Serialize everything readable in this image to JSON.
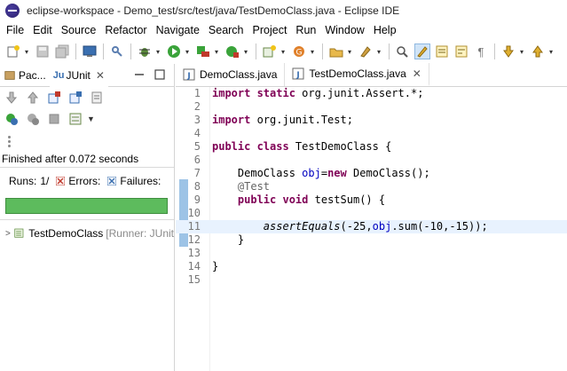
{
  "window": {
    "title": "eclipse-workspace - Demo_test/src/test/java/TestDemoClass.java - Eclipse IDE"
  },
  "menu": [
    "File",
    "Edit",
    "Source",
    "Refactor",
    "Navigate",
    "Search",
    "Project",
    "Run",
    "Window",
    "Help"
  ],
  "toolbar": {
    "icons": [
      "new-icon",
      "save-icon",
      "save-all-icon",
      "terminal-icon",
      "link-icon",
      "debug-icon",
      "run-icon",
      "coverage-icon",
      "external-tools-icon",
      "new-class-icon",
      "open-task-icon",
      "toggle-breadcrumb-icon",
      "mark-occurrences-icon",
      "block-selection-icon",
      "show-whitespace-icon",
      "next-annotation-icon",
      "previous-annotation-icon",
      "back-icon",
      "forward-icon"
    ]
  },
  "left_panel": {
    "tabs": [
      {
        "label": "Pac..."
      },
      {
        "label": "JUnit"
      }
    ],
    "status": "Finished after 0.072 seconds",
    "runs_label": "Runs:",
    "runs_value": "1/",
    "errors_label": "Errors:",
    "failures_label": "Failures:",
    "progress_fraction": 1.0,
    "progress_color": "#5dbb5d",
    "tree": {
      "name": "TestDemoClass",
      "runner": "[Runner: JUnit"
    }
  },
  "editor": {
    "tabs": [
      {
        "label": "DemoClass.java",
        "active": false
      },
      {
        "label": "TestDemoClass.java",
        "active": true
      }
    ],
    "current_line": 11,
    "lines": [
      {
        "n": "1",
        "segments": [
          {
            "t": "import static",
            "c": "kw"
          },
          {
            "t": " org.junit.Assert.*;",
            "c": ""
          }
        ]
      },
      {
        "n": "2",
        "segments": []
      },
      {
        "n": "3",
        "segments": [
          {
            "t": "import",
            "c": "kw"
          },
          {
            "t": " org.junit.Test;",
            "c": ""
          }
        ]
      },
      {
        "n": "4",
        "segments": []
      },
      {
        "n": "5",
        "segments": [
          {
            "t": "public class",
            "c": "kw"
          },
          {
            "t": " TestDemoClass {",
            "c": ""
          }
        ]
      },
      {
        "n": "6",
        "segments": []
      },
      {
        "n": "7",
        "segments": [
          {
            "t": "    DemoClass ",
            "c": ""
          },
          {
            "t": "obj",
            "c": "fld"
          },
          {
            "t": "=",
            "c": ""
          },
          {
            "t": "new",
            "c": "kw"
          },
          {
            "t": " DemoClass();",
            "c": ""
          }
        ]
      },
      {
        "n": "8",
        "segments": [
          {
            "t": "    ",
            "c": ""
          },
          {
            "t": "@Test",
            "c": "ann"
          }
        ]
      },
      {
        "n": "9",
        "segments": [
          {
            "t": "    ",
            "c": ""
          },
          {
            "t": "public void",
            "c": "kw"
          },
          {
            "t": " testSum() {",
            "c": ""
          }
        ]
      },
      {
        "n": "10",
        "segments": []
      },
      {
        "n": "11",
        "segments": [
          {
            "t": "        ",
            "c": ""
          },
          {
            "t": "assertEquals",
            "c": "ital"
          },
          {
            "t": "(-25,",
            "c": ""
          },
          {
            "t": "obj",
            "c": "fld"
          },
          {
            "t": ".sum(-10,-15));",
            "c": ""
          }
        ]
      },
      {
        "n": "12",
        "segments": [
          {
            "t": "    }",
            "c": ""
          }
        ]
      },
      {
        "n": "13",
        "segments": []
      },
      {
        "n": "14",
        "segments": [
          {
            "t": "}",
            "c": ""
          }
        ]
      },
      {
        "n": "15",
        "segments": []
      }
    ]
  }
}
